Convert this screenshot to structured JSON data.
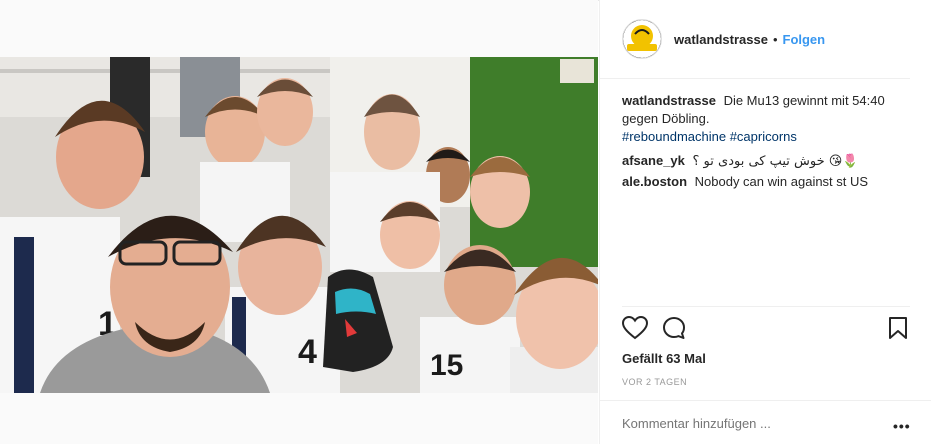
{
  "post": {
    "username": "watlandstrasse",
    "separator": "•",
    "follow_label": "Folgen",
    "avatar_text": "CAPRICORNS",
    "caption": {
      "user": "watlandstrasse",
      "text": "Die Mu13 gewinnt mit 54:40 gegen Döbling.",
      "hashtags": [
        "#reboundmachine",
        "#capricorns"
      ]
    },
    "comments": [
      {
        "user": "afsane_yk",
        "text": "خوش تیپ کی بودی تو ؟ 😘🌷"
      },
      {
        "user": "ale.boston",
        "text": "Nobody can win against st US"
      }
    ],
    "likes_label": "Gefällt 63 Mal",
    "timestamp": "VOR 2 TAGEN",
    "add_comment_placeholder": "Kommentar hinzufügen ...",
    "more_label": "•••"
  },
  "photo": {
    "jersey_number_1": "1",
    "jersey_number_2": "4",
    "jersey_number_3": "15",
    "wall_sign": "—"
  },
  "colors": {
    "link": "#3897f0",
    "hashtag": "#003569",
    "muted": "#999999",
    "wall_green": "#3f7d2a"
  },
  "icons": [
    "heart-icon",
    "comment-icon",
    "bookmark-icon"
  ]
}
